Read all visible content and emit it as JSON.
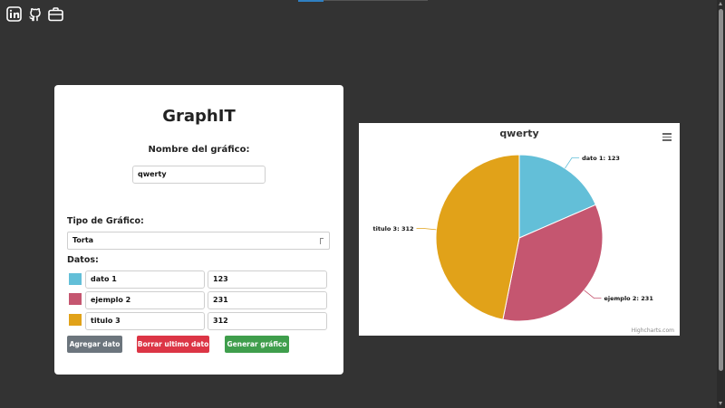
{
  "social_icons": [
    {
      "name": "linkedin-icon"
    },
    {
      "name": "github-icon"
    },
    {
      "name": "briefcase-icon"
    }
  ],
  "form": {
    "title": "GraphIT",
    "chart_name_label": "Nombre del gráfico:",
    "chart_name_value": "qwerty",
    "type_label": "Tipo de Gráfico:",
    "type_value": "Torta",
    "data_label": "Datos:",
    "rows": [
      {
        "color": "#63bfd8",
        "name": "dato 1",
        "value": "123"
      },
      {
        "color": "#c55670",
        "name": "ejemplo 2",
        "value": "231"
      },
      {
        "color": "#e1a219",
        "name": "titulo 3",
        "value": "312"
      }
    ],
    "buttons": {
      "add": "Agregar dato",
      "delete": "Borrar ultimo dato",
      "generate": "Generar gráfico"
    }
  },
  "chart": {
    "credits": "Highcharts.com"
  },
  "chart_data": {
    "type": "pie",
    "title": "qwerty",
    "categories": [
      "dato 1",
      "ejemplo 2",
      "titulo 3"
    ],
    "values": [
      123,
      231,
      312
    ],
    "colors": [
      "#63bfd8",
      "#c55670",
      "#e1a219"
    ],
    "data_labels": [
      "dato 1: 123",
      "ejemplo 2: 231",
      "titulo 3: 312"
    ]
  }
}
